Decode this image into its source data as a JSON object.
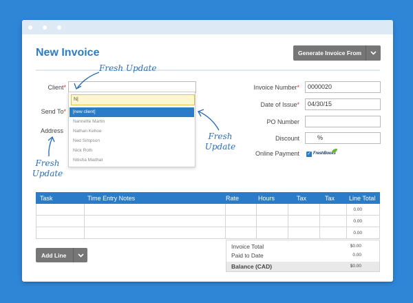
{
  "window": {
    "title": "New Invoice"
  },
  "header": {
    "generate_label": "Generate Invoice From"
  },
  "client": {
    "label": "Client",
    "required": "*",
    "value": ""
  },
  "send_to": {
    "label": "Send To",
    "required": "*"
  },
  "address": {
    "label": "Address"
  },
  "dropdown": {
    "search_value": "N|",
    "items": [
      "[new client]",
      "Nannette Martin",
      "Nathan Kehoe",
      "Ned Simpson",
      "Nick Roth",
      "Nitisha Madhat"
    ],
    "active_index": 0
  },
  "invoice": {
    "number_label": "Invoice Number",
    "number_required": "*",
    "number_value": "0000020",
    "date_label": "Date of Issue",
    "date_required": "*",
    "date_value": "04/30/15",
    "po_label": "PO Number",
    "po_value": "",
    "discount_label": "Discount",
    "discount_value": "%",
    "online_payment_label": "Online Payment",
    "online_payment_checked": true,
    "payment_logo": "FreshBooks"
  },
  "annotations": [
    "Fresh Update",
    "Fresh Update",
    "Fresh Update"
  ],
  "table": {
    "columns": [
      "Task",
      "Time Entry Notes",
      "Rate",
      "Hours",
      "Tax",
      "Tax",
      "Line Total"
    ],
    "rows": [
      {
        "line_total": "0.00"
      },
      {
        "line_total": "0.00"
      },
      {
        "line_total": "0.00"
      }
    ]
  },
  "add_line_label": "Add Line",
  "totals": {
    "invoice_total_label": "Invoice Total",
    "invoice_total_value": "$0.00",
    "paid_label": "Paid to Date",
    "paid_value": "0.00",
    "balance_label": "Balance (CAD)",
    "balance_value": "$0.00"
  },
  "colors": {
    "brand": "#2a7cc9",
    "background": "#2f86d6",
    "button": "#767676"
  }
}
